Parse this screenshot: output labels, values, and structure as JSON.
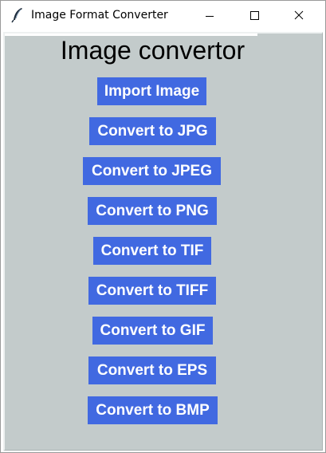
{
  "window": {
    "title": "Image Format Converter",
    "icon": "feather-icon",
    "controls": [
      "minimize-icon",
      "maximize-icon",
      "close-icon"
    ]
  },
  "app": {
    "heading": "Image convertor",
    "background_color": "#c3cbcb",
    "button_color": "#4169e1",
    "button_text_color": "#ffffff"
  },
  "buttons": [
    {
      "label": "Import Image"
    },
    {
      "label": "Convert to JPG"
    },
    {
      "label": "Convert to JPEG"
    },
    {
      "label": "Convert to PNG"
    },
    {
      "label": "Convert to TIF"
    },
    {
      "label": "Convert to TIFF"
    },
    {
      "label": "Convert to GIF"
    },
    {
      "label": "Convert to EPS"
    },
    {
      "label": "Convert to BMP"
    }
  ]
}
